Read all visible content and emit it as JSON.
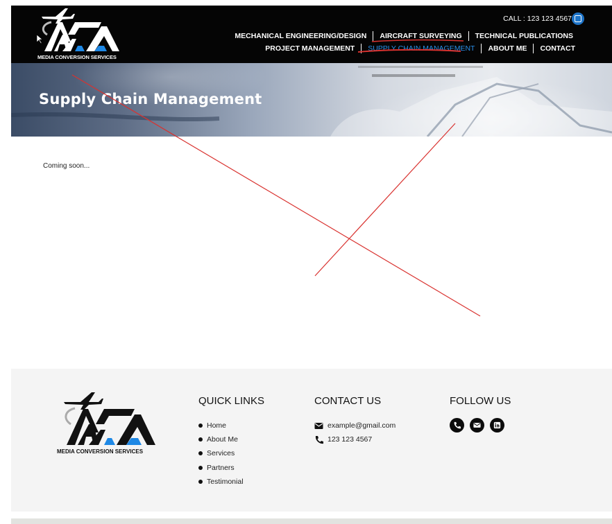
{
  "header": {
    "logo_caption": "MEDIA CONVERSION SERVICES",
    "call_text": "CALL : 123 123 4567",
    "nav_row1": [
      {
        "label": "MECHANICAL ENGINEERING/DESIGN",
        "active": false
      },
      {
        "label": "AIRCRAFT SURVEYING",
        "active": false
      },
      {
        "label": "TECHNICAL PUBLICATIONS",
        "active": false
      }
    ],
    "nav_row2": [
      {
        "label": "PROJECT MANAGEMENT",
        "active": false
      },
      {
        "label": "SUPPLY CHAIN MANAGEMENT",
        "active": true
      },
      {
        "label": "ABOUT ME",
        "active": false
      },
      {
        "label": "CONTACT",
        "active": false
      }
    ]
  },
  "hero": {
    "title": "Supply Chain Management"
  },
  "main": {
    "body_text": "Coming soon..."
  },
  "footer": {
    "logo_caption": "MEDIA CONVERSION SERVICES",
    "quick_links": {
      "heading": "QUICK LINKS",
      "items": [
        "Home",
        "About Me",
        "Services",
        "Partners",
        "Testimonial"
      ]
    },
    "contact": {
      "heading": "CONTACT US",
      "email": "example@gmail.com",
      "phone": "123 123 4567"
    },
    "follow": {
      "heading": "FOLLOW US",
      "icons": [
        "phone-icon",
        "email-icon",
        "linkedin-icon"
      ]
    }
  },
  "colors": {
    "header_bg": "#050505",
    "active_nav": "#2a8fe8",
    "linkedin_blue": "#1d73c7",
    "footer_bg": "#f4f4f4",
    "annotation_red": "#d9322f"
  }
}
